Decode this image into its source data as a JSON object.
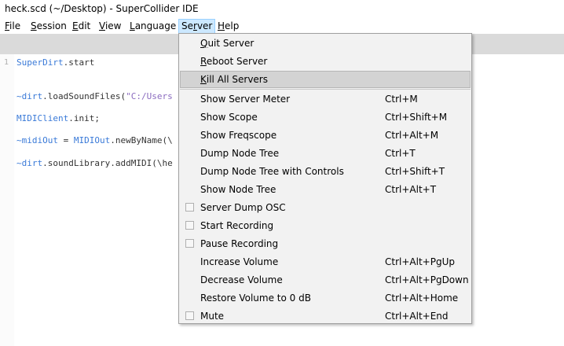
{
  "window": {
    "title": "heck.scd (~/Desktop) - SuperCollider IDE"
  },
  "menubar": {
    "items": [
      {
        "pre": "",
        "u": "F",
        "post": "ile"
      },
      {
        "pre": "",
        "u": "S",
        "post": "ession"
      },
      {
        "pre": "",
        "u": "E",
        "post": "dit"
      },
      {
        "pre": "",
        "u": "V",
        "post": "iew"
      },
      {
        "pre": "",
        "u": "L",
        "post": "anguage"
      },
      {
        "pre": "Se",
        "u": "r",
        "post": "ver"
      },
      {
        "pre": "",
        "u": "H",
        "post": "elp"
      }
    ]
  },
  "editor": {
    "lines": [
      {
        "num": "1",
        "parts": [
          {
            "cls": "cls",
            "t": "SuperDirt"
          },
          {
            "cls": "pl",
            "t": ".start"
          }
        ]
      },
      {
        "num": "",
        "parts": [
          {
            "cls": "env",
            "t": "~dirt"
          },
          {
            "cls": "pl",
            "t": ".loadSoundFiles("
          },
          {
            "cls": "str",
            "t": "\"C:/Users"
          }
        ]
      },
      {
        "num": "",
        "parts": [
          {
            "cls": "cls",
            "t": "MIDIClient"
          },
          {
            "cls": "pl",
            "t": ".init;"
          }
        ]
      },
      {
        "num": "",
        "parts": [
          {
            "cls": "env",
            "t": "~midiOut"
          },
          {
            "cls": "pl",
            "t": " = "
          },
          {
            "cls": "cls",
            "t": "MIDIOut"
          },
          {
            "cls": "pl",
            "t": ".newByName(\\"
          }
        ]
      },
      {
        "num": "",
        "parts": [
          {
            "cls": "env",
            "t": "~dirt"
          },
          {
            "cls": "pl",
            "t": ".soundLibrary.addMIDI(\\he"
          }
        ]
      }
    ]
  },
  "server_menu": {
    "items": [
      {
        "pre": "",
        "u": "Q",
        "post": "uit Server",
        "shortcut": "",
        "checkbox": false,
        "highlighted": false
      },
      {
        "pre": "",
        "u": "R",
        "post": "eboot Server",
        "shortcut": "",
        "checkbox": false,
        "highlighted": false
      },
      {
        "pre": "",
        "u": "K",
        "post": "ill All Servers",
        "shortcut": "",
        "checkbox": false,
        "highlighted": true
      },
      {
        "pre": "Show Server Meter",
        "u": "",
        "post": "",
        "shortcut": "Ctrl+M",
        "checkbox": false,
        "highlighted": false
      },
      {
        "pre": "Show Scope",
        "u": "",
        "post": "",
        "shortcut": "Ctrl+Shift+M",
        "checkbox": false,
        "highlighted": false
      },
      {
        "pre": "Show Freqscope",
        "u": "",
        "post": "",
        "shortcut": "Ctrl+Alt+M",
        "checkbox": false,
        "highlighted": false
      },
      {
        "pre": "Dump Node Tree",
        "u": "",
        "post": "",
        "shortcut": "Ctrl+T",
        "checkbox": false,
        "highlighted": false
      },
      {
        "pre": "Dump Node Tree with Controls",
        "u": "",
        "post": "",
        "shortcut": "Ctrl+Shift+T",
        "checkbox": false,
        "highlighted": false
      },
      {
        "pre": "Show Node Tree",
        "u": "",
        "post": "",
        "shortcut": "Ctrl+Alt+T",
        "checkbox": false,
        "highlighted": false
      },
      {
        "pre": "Server Dump OSC",
        "u": "",
        "post": "",
        "shortcut": "",
        "checkbox": true,
        "highlighted": false
      },
      {
        "pre": "Start Recording",
        "u": "",
        "post": "",
        "shortcut": "",
        "checkbox": true,
        "highlighted": false
      },
      {
        "pre": "Pause Recording",
        "u": "",
        "post": "",
        "shortcut": "",
        "checkbox": true,
        "highlighted": false
      },
      {
        "pre": "Increase Volume",
        "u": "",
        "post": "",
        "shortcut": "Ctrl+Alt+PgUp",
        "checkbox": false,
        "highlighted": false
      },
      {
        "pre": "Decrease Volume",
        "u": "",
        "post": "",
        "shortcut": "Ctrl+Alt+PgDown",
        "checkbox": false,
        "highlighted": false
      },
      {
        "pre": "Restore Volume to 0 dB",
        "u": "",
        "post": "",
        "shortcut": "Ctrl+Alt+Home",
        "checkbox": false,
        "highlighted": false
      },
      {
        "pre": "Mute",
        "u": "",
        "post": "",
        "shortcut": "Ctrl+Alt+End",
        "checkbox": true,
        "highlighted": false
      }
    ]
  }
}
